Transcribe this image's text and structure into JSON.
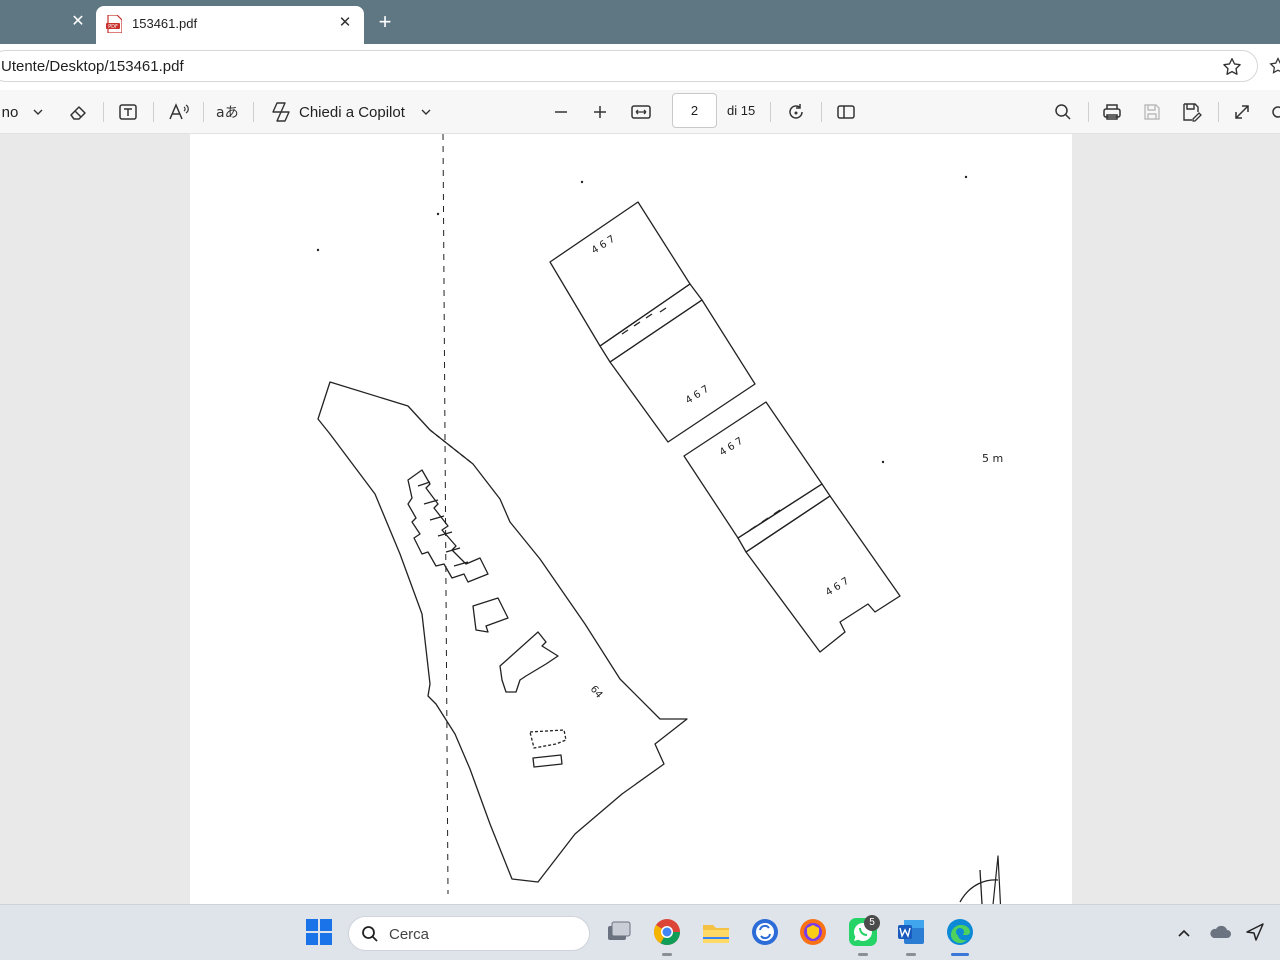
{
  "tabs": {
    "active_title": "153461.pdf"
  },
  "address": {
    "url": "Utente/Desktop/153461.pdf"
  },
  "toolbar": {
    "draw_label": "no",
    "copilot_label": "Chiedi a Copilot",
    "page_current": "2",
    "page_total": "di 15"
  },
  "document": {
    "annotations": {
      "n1": "4 6 7",
      "n2": "4 6 7",
      "n3": "4 6 7",
      "n4": "4 6 7",
      "n5": "64",
      "n6": "5 m"
    }
  },
  "taskbar": {
    "search_placeholder": "Cerca",
    "whatsapp_badge": "5"
  },
  "colors": {
    "tabstrip": "#5f7683",
    "taskbar": "#dfe3ea",
    "viewer_bg": "#e9e9e9"
  }
}
